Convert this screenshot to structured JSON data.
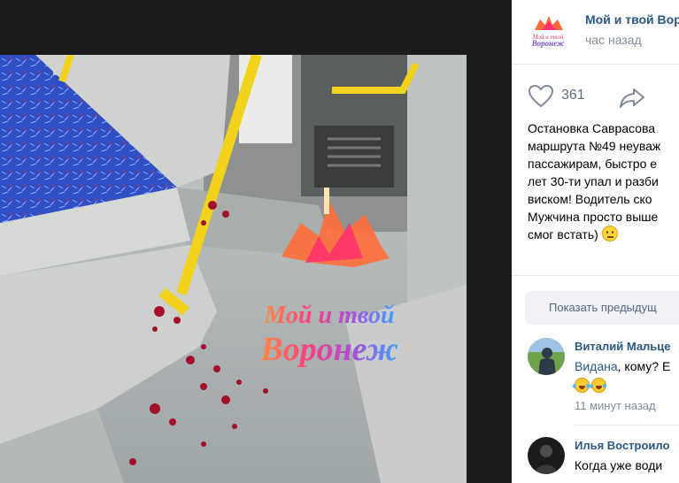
{
  "post": {
    "group_name": "Мой и твой Вор",
    "time": "час назад",
    "avatar_logo_text": "Мой и твой Воронеж",
    "likes": "361",
    "text_lines": [
      "Остановка Саврасова",
      "маршрута №49 неуваж",
      "пассажирам, быстро е",
      "лет 30-ти упал и разби",
      "виском! Водитель ско",
      "Мужчина просто выше",
      "смог встать)"
    ]
  },
  "photo": {
    "watermark_line1": "Мой и твой",
    "watermark_line2": "Воронеж"
  },
  "comments_button": "Показать предыдущ",
  "comments": [
    {
      "name": "Виталий Мальце",
      "reply_to": "Видана",
      "text": ", кому? Е",
      "time": "11 минут назад"
    },
    {
      "name": "Илья Востроило",
      "text": "Когда уже води"
    }
  ],
  "colors": {
    "link": "#2a5885",
    "muted": "#818c99",
    "seat_blue": "#2f4fc4",
    "pole_yellow": "#f2d21a"
  },
  "icons": [
    "heart-icon",
    "share-icon",
    "neutral-face-emoji",
    "laughing-emoji"
  ]
}
